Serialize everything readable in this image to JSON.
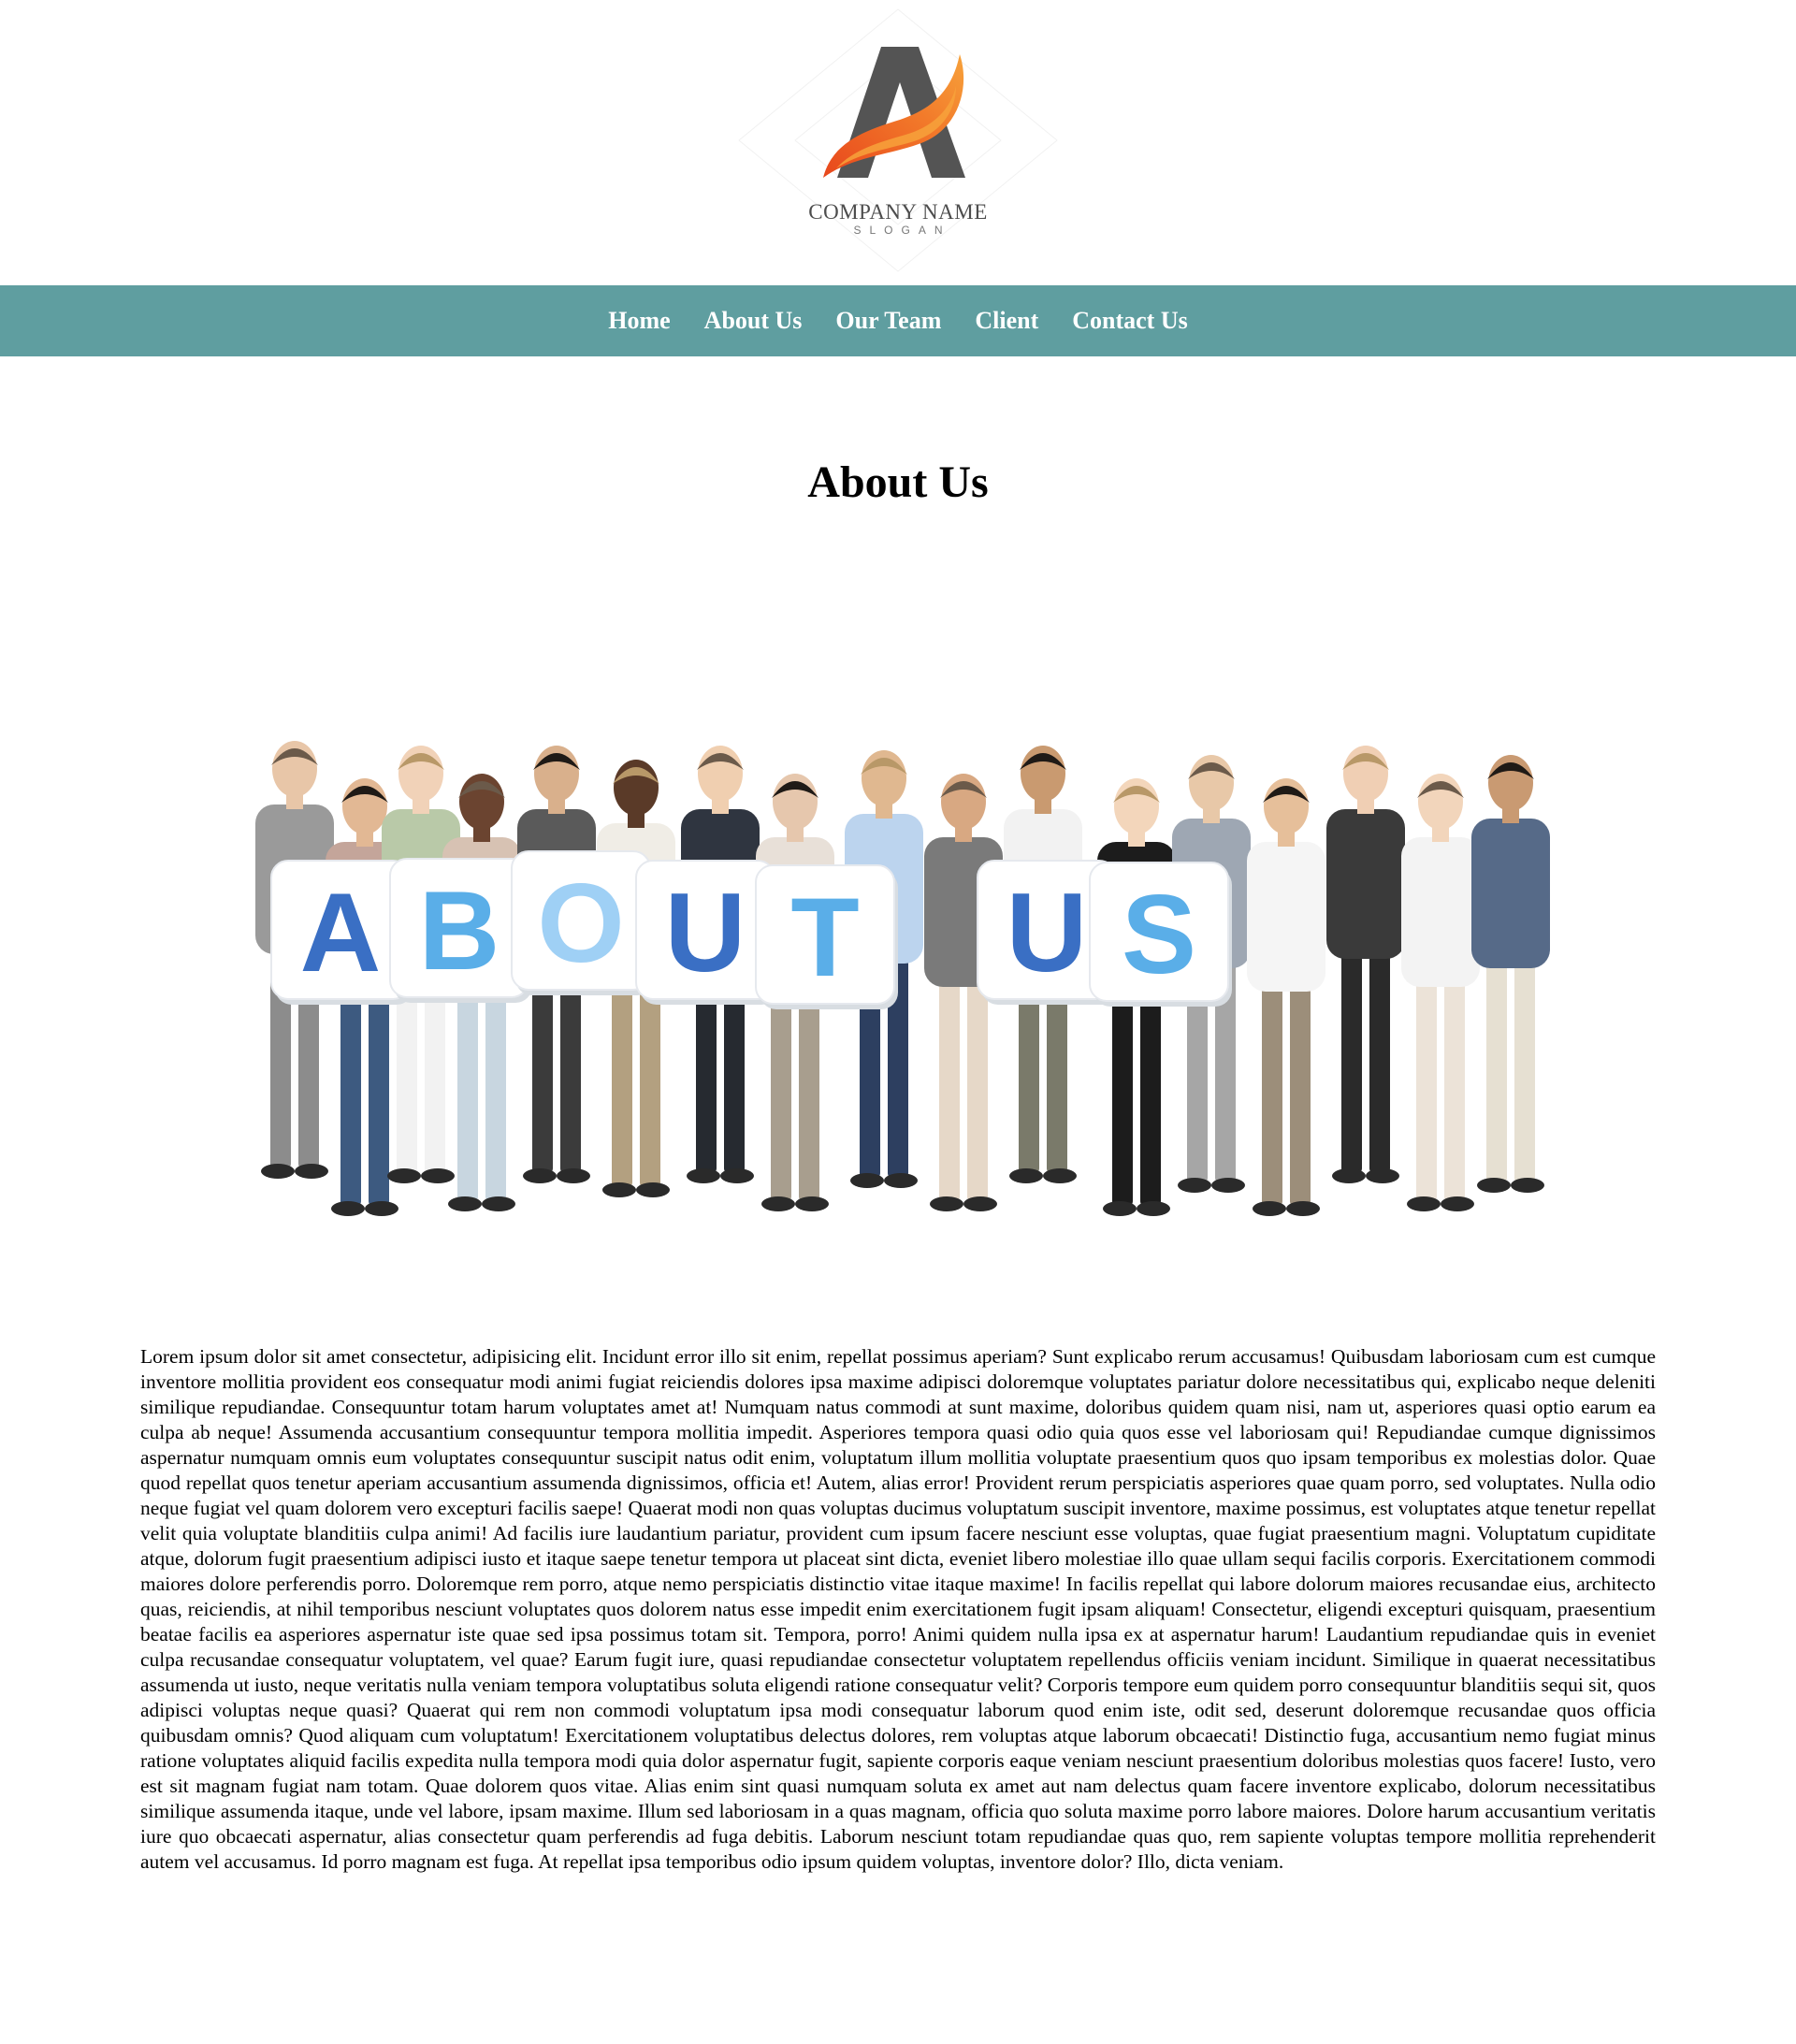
{
  "header": {
    "logo": {
      "letter": "A",
      "company_name": "COMPANY NAME",
      "slogan": "SLOGAN",
      "colors": {
        "letter": "#545454",
        "swoosh_light": "#f7a23b",
        "swoosh_dark": "#e8471c"
      }
    }
  },
  "nav": {
    "background": "#5f9ea0",
    "items": [
      {
        "label": "Home"
      },
      {
        "label": "About Us"
      },
      {
        "label": "Our Team"
      },
      {
        "label": "Client"
      },
      {
        "label": "Contact Us"
      }
    ]
  },
  "main": {
    "title": "About Us",
    "hero_image": {
      "card_letters": [
        "A",
        "B",
        "O",
        "U",
        "T",
        "U",
        "S"
      ],
      "card_colors": [
        "#3a6fc4",
        "#5aaee8",
        "#9fd0f5",
        "#3a6fc4",
        "#5aaee8",
        "#3a6fc4",
        "#5aaee8"
      ]
    },
    "paragraph": "Lorem ipsum dolor sit amet consectetur, adipisicing elit. Incidunt error illo sit enim, repellat possimus aperiam? Sunt explicabo rerum accusamus! Quibusdam laboriosam cum est cumque inventore mollitia provident eos consequatur modi animi fugiat reiciendis dolores ipsa maxime adipisci doloremque voluptates pariatur dolore necessitatibus qui, explicabo neque deleniti similique repudiandae. Consequuntur totam harum voluptates amet at! Numquam natus commodi at sunt maxime, doloribus quidem quam nisi, nam ut, asperiores quasi optio earum ea culpa ab neque! Assumenda accusantium consequuntur tempora mollitia impedit. Asperiores tempora quasi odio quia quos esse vel laboriosam qui! Repudiandae cumque dignissimos aspernatur numquam omnis eum voluptates consequuntur suscipit natus odit enim, voluptatum illum mollitia voluptate praesentium quos quo ipsam temporibus ex molestias dolor. Quae quod repellat quos tenetur aperiam accusantium assumenda dignissimos, officia et! Autem, alias error! Provident rerum perspiciatis asperiores quae quam porro, sed voluptates. Nulla odio neque fugiat vel quam dolorem vero excepturi facilis saepe! Quaerat modi non quas voluptas ducimus voluptatum suscipit inventore, maxime possimus, est voluptates atque tenetur repellat velit quia voluptate blanditiis culpa animi! Ad facilis iure laudantium pariatur, provident cum ipsum facere nesciunt esse voluptas, quae fugiat praesentium magni. Voluptatum cupiditate atque, dolorum fugit praesentium adipisci iusto et itaque saepe tenetur tempora ut placeat sint dicta, eveniet libero molestiae illo quae ullam sequi facilis corporis. Exercitationem commodi maiores dolore perferendis porro. Doloremque rem porro, atque nemo perspiciatis distinctio vitae itaque maxime! In facilis repellat qui labore dolorum maiores recusandae eius, architecto quas, reiciendis, at nihil temporibus nesciunt voluptates quos dolorem natus esse impedit enim exercitationem fugit ipsam aliquam! Consectetur, eligendi excepturi quisquam, praesentium beatae facilis ea asperiores aspernatur iste quae sed ipsa possimus totam sit. Tempora, porro! Animi quidem nulla ipsa ex at aspernatur harum! Laudantium repudiandae quis in eveniet culpa recusandae consequatur voluptatem, vel quae? Earum fugit iure, quasi repudiandae consectetur voluptatem repellendus officiis veniam incidunt. Similique in quaerat necessitatibus assumenda ut iusto, neque veritatis nulla veniam tempora voluptatibus soluta eligendi ratione consequatur velit? Corporis tempore eum quidem porro consequuntur blanditiis sequi sit, quos adipisci voluptas neque quasi? Quaerat qui rem non commodi voluptatum ipsa modi consequatur laborum quod enim iste, odit sed, deserunt doloremque recusandae quos officia quibusdam omnis? Quod aliquam cum voluptatum! Exercitationem voluptatibus delectus dolores, rem voluptas atque laborum obcaecati! Distinctio fuga, accusantium nemo fugiat minus ratione voluptates aliquid facilis expedita nulla tempora modi quia dolor aspernatur fugit, sapiente corporis eaque veniam nesciunt praesentium doloribus molestias quos facere! Iusto, vero est sit magnam fugiat nam totam. Quae dolorem quos vitae. Alias enim sint quasi numquam soluta ex amet aut nam delectus quam facere inventore explicabo, dolorum necessitatibus similique assumenda itaque, unde vel labore, ipsam maxime. Illum sed laboriosam in a quas magnam, officia quo soluta maxime porro labore maiores. Dolore harum accusantium veritatis iure quo obcaecati aspernatur, alias consectetur quam perferendis ad fuga debitis. Laborum nesciunt totam repudiandae quas quo, rem sapiente voluptas tempore mollitia reprehenderit autem vel accusamus. Id porro magnam est fuga. At repellat ipsa temporibus odio ipsum quidem voluptas, inventore dolor? Illo, dicta veniam."
  }
}
